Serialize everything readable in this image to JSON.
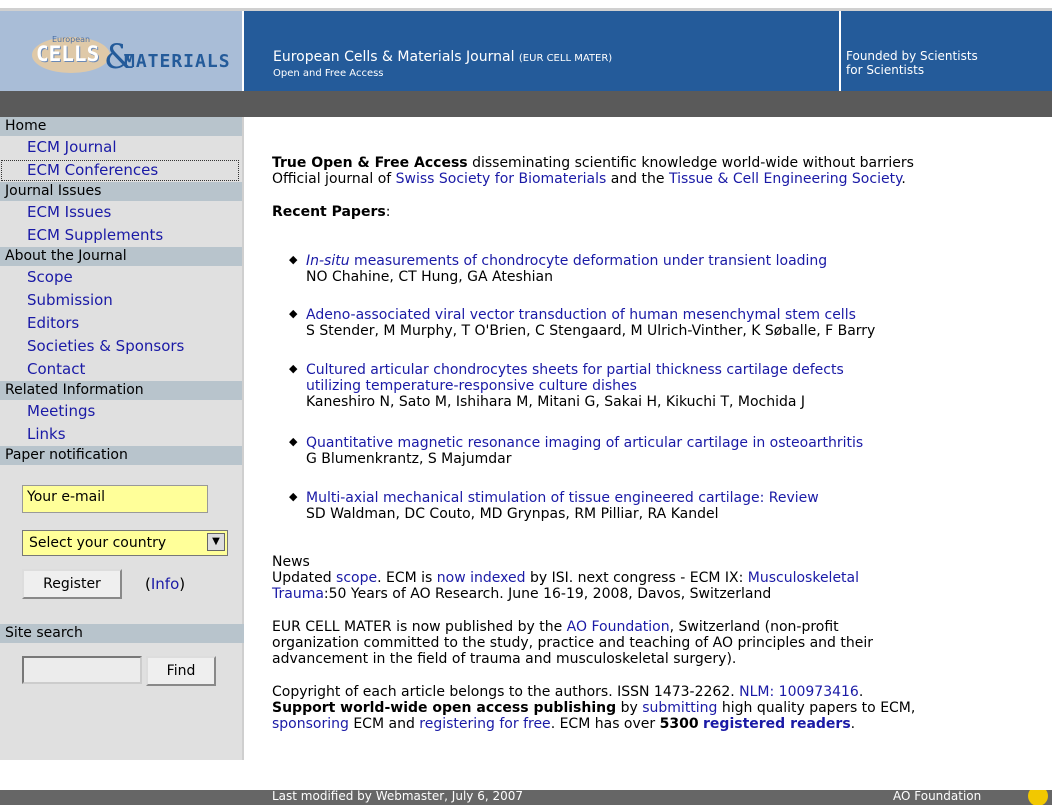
{
  "header": {
    "logo_small": "European",
    "logo_main": "CELLS",
    "logo_amp": "&",
    "logo_mat": "MATERIALS",
    "title": "European Cells & Materials Journal",
    "title_abbr": "(EUR CELL MATER)",
    "subtitle": "Open and Free Access",
    "tagline_1": "Founded by Scientists",
    "tagline_2": "for Scientists"
  },
  "sidebar": {
    "home": "Home",
    "ecm_journal": "ECM Journal",
    "ecm_conferences": "ECM Conferences",
    "journal_issues": "Journal Issues",
    "ecm_issues": "ECM Issues",
    "ecm_supplements": "ECM Supplements",
    "about": "About the Journal",
    "scope": "Scope",
    "submission": "Submission",
    "editors": "Editors",
    "societies": "Societies & Sponsors",
    "contact": "Contact",
    "related": "Related Information",
    "meetings": "Meetings",
    "links": "Links",
    "paper_notification": "Paper notification",
    "email_value": "Your e-mail",
    "country_value": "Select your country",
    "register": "Register",
    "info_open": "(",
    "info_link": "Info",
    "info_close": ")",
    "site_search": "Site search",
    "find": "Find"
  },
  "intro": {
    "bold": "True Open & Free Access",
    "rest": " disseminating scientific knowledge world-wide without barriers",
    "line2_a": "Official journal of ",
    "ssb": "Swiss Society for Biomaterials",
    "line2_b": " and the ",
    "tces": "Tissue & Cell Engineering Society",
    "line2_c": "."
  },
  "recent_label": "Recent Papers",
  "recent_colon": ":",
  "papers": [
    {
      "title_italic": "In-situ",
      "title": " measurements of chondrocyte deformation under transient loading",
      "authors": "NO Chahine, CT Hung, GA Ateshian"
    },
    {
      "title": "Adeno-associated viral vector transduction of human mesenchymal stem cells",
      "authors": "S Stender, M Murphy, T O'Brien, C Stengaard, M Ulrich-Vinther, K Søballe, F Barry"
    },
    {
      "title": "Cultured articular chondrocytes sheets for partial thickness cartilage defects",
      "title2": "utilizing temperature-responsive culture dishes",
      "authors": "Kaneshiro N, Sato M, Ishihara M, Mitani G, Sakai H, Kikuchi T, Mochida J"
    },
    {
      "title": "Quantitative magnetic resonance imaging of articular cartilage in osteoarthritis",
      "authors": "G Blumenkrantz, S Majumdar"
    },
    {
      "title": "Multi-axial mechanical stimulation of tissue engineered cartilage: Review",
      "authors": "SD Waldman, DC Couto, MD Grynpas, RM Pilliar, RA Kandel"
    }
  ],
  "news": {
    "heading": "News",
    "a": "Updated ",
    "scope": "scope",
    "b": ". ECM is ",
    "indexed": "now indexed",
    "c": " by ISI. next congress - ECM IX: ",
    "congress_1": "Musculoskeletal",
    "congress_2": "Trauma",
    "d": ":50 Years of AO Research. June 16-19, 2008, Davos, Switzerland"
  },
  "ao": {
    "a": "EUR CELL MATER is now published by the ",
    "link": "AO Foundation",
    "b": ", Switzerland (non-profit",
    "line2": "organization committed to the study, practice and teaching of AO principles and their",
    "line3": "advancement in the field of trauma and musculoskeletal surgery)."
  },
  "copyright": {
    "a": "Copyright of each article belongs to the authors. ISSN 1473-2262. ",
    "nlm": "NLM: 100973416",
    "b": ".",
    "support_bold": "Support world-wide open access publishing",
    "c": " by ",
    "submitting": "submitting",
    "d": " high quality papers to ECM,",
    "sponsoring": "sponsoring",
    "e": " ECM and ",
    "registering": "registering for free",
    "f": ". ECM has over ",
    "count": "5300",
    "g": " ",
    "readers": "registered readers",
    "h": "."
  },
  "footer": {
    "modified": "Last modified by Webmaster, July 6, 2007",
    "ao": "AO Foundation"
  }
}
